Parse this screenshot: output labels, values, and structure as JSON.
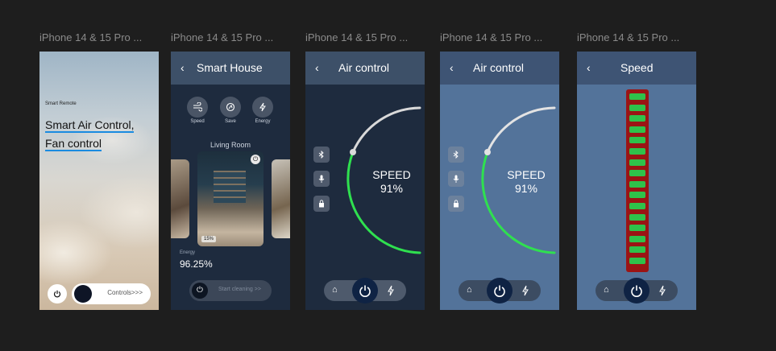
{
  "frames": {
    "f1": {
      "label": "iPhone 14 & 15 Pro ...",
      "small_title": "Smart Remote",
      "line1": "Smart Air Control,",
      "line2": "Fan control",
      "controls": "Controls>>>"
    },
    "f2": {
      "label": "iPhone 14 & 15 Pro ...",
      "title": "Smart House",
      "icons": [
        {
          "label": "Speed",
          "icon": "fan-icon"
        },
        {
          "label": "Save",
          "icon": "eco-icon"
        },
        {
          "label": "Energy",
          "icon": "bolt-icon"
        }
      ],
      "room": "Living Room",
      "room_badge": "15%",
      "energy_label": "Energy",
      "energy_value": "96.25%",
      "start_btn": "Start cleaning >>"
    },
    "f3": {
      "label": "iPhone 14 & 15 Pro ...",
      "title": "Air control",
      "speed_label": "SPEED",
      "speed_value": "91%"
    },
    "f4": {
      "label": "iPhone 14 & 15 Pro ...",
      "title": "Air control",
      "speed_label": "SPEED",
      "speed_value": "91%"
    },
    "f5": {
      "label": "iPhone 14 & 15 Pro ...",
      "title": "Speed",
      "level_segments": 16
    }
  },
  "colors": {
    "dark_panel": "#1e2b3e",
    "dark_header": "#3d5068",
    "light_panel": "#53739a",
    "light_header": "#3e5474",
    "accent_green": "#2fe04f",
    "speed_frame": "#9b1414",
    "segment_green": "#2fc24a"
  }
}
